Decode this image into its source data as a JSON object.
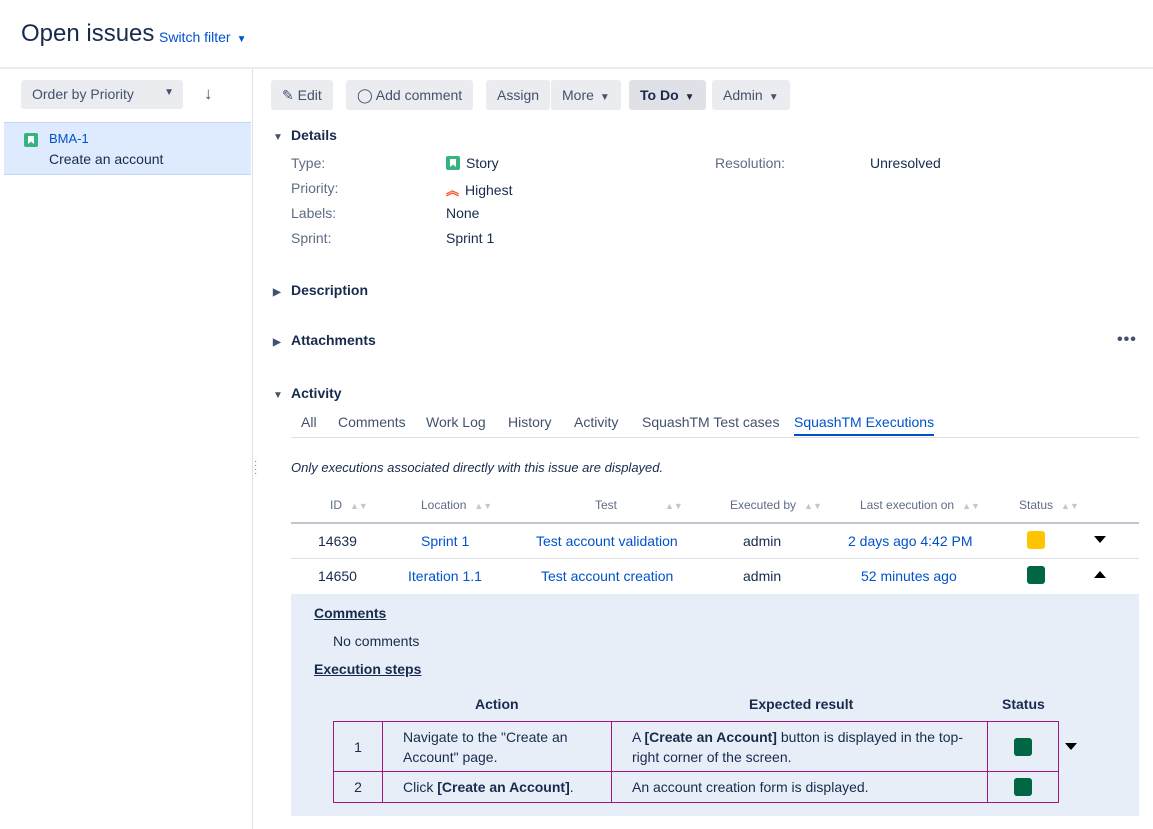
{
  "header": {
    "title": "Open issues",
    "switch_filter": "Switch filter"
  },
  "sidebar": {
    "order_label": "Order by Priority",
    "issues": [
      {
        "key": "BMA-1",
        "summary": "Create an account"
      }
    ]
  },
  "toolbar": {
    "edit": "Edit",
    "add_comment": "Add comment",
    "assign": "Assign",
    "more": "More",
    "status": "To Do",
    "admin": "Admin"
  },
  "details": {
    "title": "Details",
    "type_label": "Type:",
    "type_value": "Story",
    "priority_label": "Priority:",
    "priority_value": "Highest",
    "labels_label": "Labels:",
    "labels_value": "None",
    "sprint_label": "Sprint:",
    "sprint_value": "Sprint 1",
    "resolution_label": "Resolution:",
    "resolution_value": "Unresolved"
  },
  "sections": {
    "description": "Description",
    "attachments": "Attachments",
    "activity": "Activity"
  },
  "activity": {
    "tabs": [
      "All",
      "Comments",
      "Work Log",
      "History",
      "Activity",
      "SquashTM Test cases",
      "SquashTM Executions"
    ],
    "active_tab": "SquashTM Executions",
    "note": "Only executions associated directly with this issue are displayed."
  },
  "executions": {
    "columns": [
      "ID",
      "Location",
      "Test",
      "Executed by",
      "Last execution on",
      "Status"
    ],
    "rows": [
      {
        "id": "14639",
        "location": "Sprint 1",
        "test": "Test account validation",
        "executed_by": "admin",
        "last_execution": "2 days ago 4:42 PM",
        "status_color": "#ffc400"
      },
      {
        "id": "14650",
        "location": "Iteration 1.1",
        "test": "Test account creation",
        "executed_by": "admin",
        "last_execution": "52 minutes ago",
        "status_color": "#006644"
      }
    ]
  },
  "details_panel": {
    "comments_title": "Comments",
    "no_comments": "No comments",
    "steps_title": "Execution steps",
    "step_columns": {
      "action": "Action",
      "expected": "Expected result",
      "status": "Status"
    },
    "steps": [
      {
        "num": "1",
        "action_pre": "Navigate to the \"Create an Account\" page.",
        "action_bold": "",
        "action_post": "",
        "expected_pre": "A ",
        "expected_bold": "[Create an Account]",
        "expected_post": " button is displayed in the top-right corner of the screen.",
        "status_color": "#006644"
      },
      {
        "num": "2",
        "action_pre": "Click ",
        "action_bold": "[Create an Account]",
        "action_post": ".",
        "expected_pre": "An account creation form is displayed.",
        "expected_bold": "",
        "expected_post": "",
        "status_color": "#006644"
      }
    ]
  }
}
